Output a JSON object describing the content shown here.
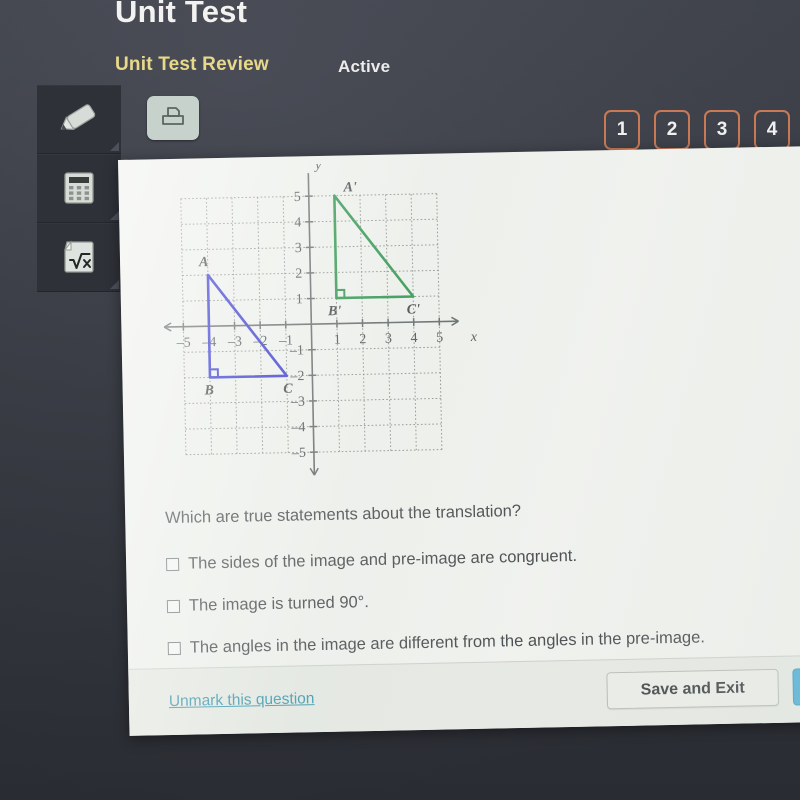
{
  "header": {
    "title": "Unit Test",
    "subtitle": "Unit Test Review",
    "status": "Active",
    "print_icon": "printer-icon"
  },
  "toolbar": {
    "tools": [
      {
        "name": "highlighter-tool",
        "icon": "highlighter-icon"
      },
      {
        "name": "calculator-tool",
        "icon": "calculator-icon"
      },
      {
        "name": "formula-tool",
        "icon": "square-root-icon",
        "label": "√x"
      }
    ]
  },
  "question_nav": {
    "numbers": [
      "1",
      "2",
      "3",
      "4"
    ]
  },
  "question": {
    "stem": "Which are true statements about the translation?",
    "options": [
      "The sides of the image and pre-image are congruent.",
      "The image is turned 90°.",
      "The angles in the image are different from the angles in the pre-image."
    ],
    "checked": [
      false,
      false,
      false
    ]
  },
  "footer": {
    "unmark_label": "Unmark this question",
    "save_label": "Save and Exit",
    "next_label": ""
  },
  "colors": {
    "preimage": "#2222cc",
    "image": "#1a8a3c",
    "accent_orange": "#c97a55",
    "link_teal": "#2a8fa8",
    "next_blue": "#3fa9d4",
    "subtitle_yellow": "#e8d98a"
  },
  "chart_data": {
    "type": "scatter",
    "title": "",
    "xlabel": "x",
    "ylabel": "y",
    "xlim": [
      -5.6,
      5.6
    ],
    "ylim": [
      -5.6,
      5.6
    ],
    "xticks": [
      -5,
      -4,
      -3,
      -2,
      -1,
      1,
      2,
      3,
      4,
      5
    ],
    "yticks": [
      5,
      4,
      3,
      2,
      1,
      -1,
      -2,
      -3,
      -4,
      -5
    ],
    "grid": true,
    "grid_style": "dotted",
    "legend": "none",
    "series": [
      {
        "name": "pre-image triangle ABC",
        "color": "#2222cc",
        "vertices": [
          {
            "label": "A",
            "x": -4,
            "y": 2
          },
          {
            "label": "B",
            "x": -4,
            "y": -2
          },
          {
            "label": "C",
            "x": -1,
            "y": -2
          }
        ],
        "right_angle_at": "B"
      },
      {
        "name": "image triangle A'B'C'",
        "color": "#1a8a3c",
        "vertices": [
          {
            "label": "A'",
            "x": 1,
            "y": 5
          },
          {
            "label": "B'",
            "x": 1,
            "y": 1
          },
          {
            "label": "C'",
            "x": 4,
            "y": 1
          }
        ],
        "right_angle_at": "B'"
      }
    ],
    "translation_vector": {
      "dx": 5,
      "dy": 3
    }
  }
}
